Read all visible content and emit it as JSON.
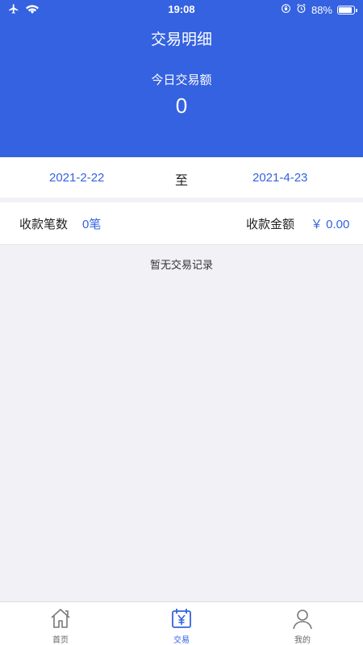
{
  "status_bar": {
    "time": "19:08",
    "battery": "88%",
    "battery_level": 0.88
  },
  "header": {
    "title": "交易明细",
    "today_label": "今日交易额",
    "today_value": "0"
  },
  "date_range": {
    "start": "2021-2-22",
    "separator": "至",
    "end": "2021-4-23"
  },
  "summary": {
    "count_label": "收款笔数",
    "count_value": "0笔",
    "amount_label": "收款金额",
    "amount_value": "￥ 0.00"
  },
  "empty_text": "暂无交易记录",
  "tabs": [
    {
      "label": "首页",
      "icon": "home-icon",
      "active": false
    },
    {
      "label": "交易",
      "icon": "transaction-icon",
      "active": true
    },
    {
      "label": "我的",
      "icon": "user-icon",
      "active": false
    }
  ],
  "colors": {
    "brand": "#3462e0",
    "background": "#f1f1f6"
  }
}
